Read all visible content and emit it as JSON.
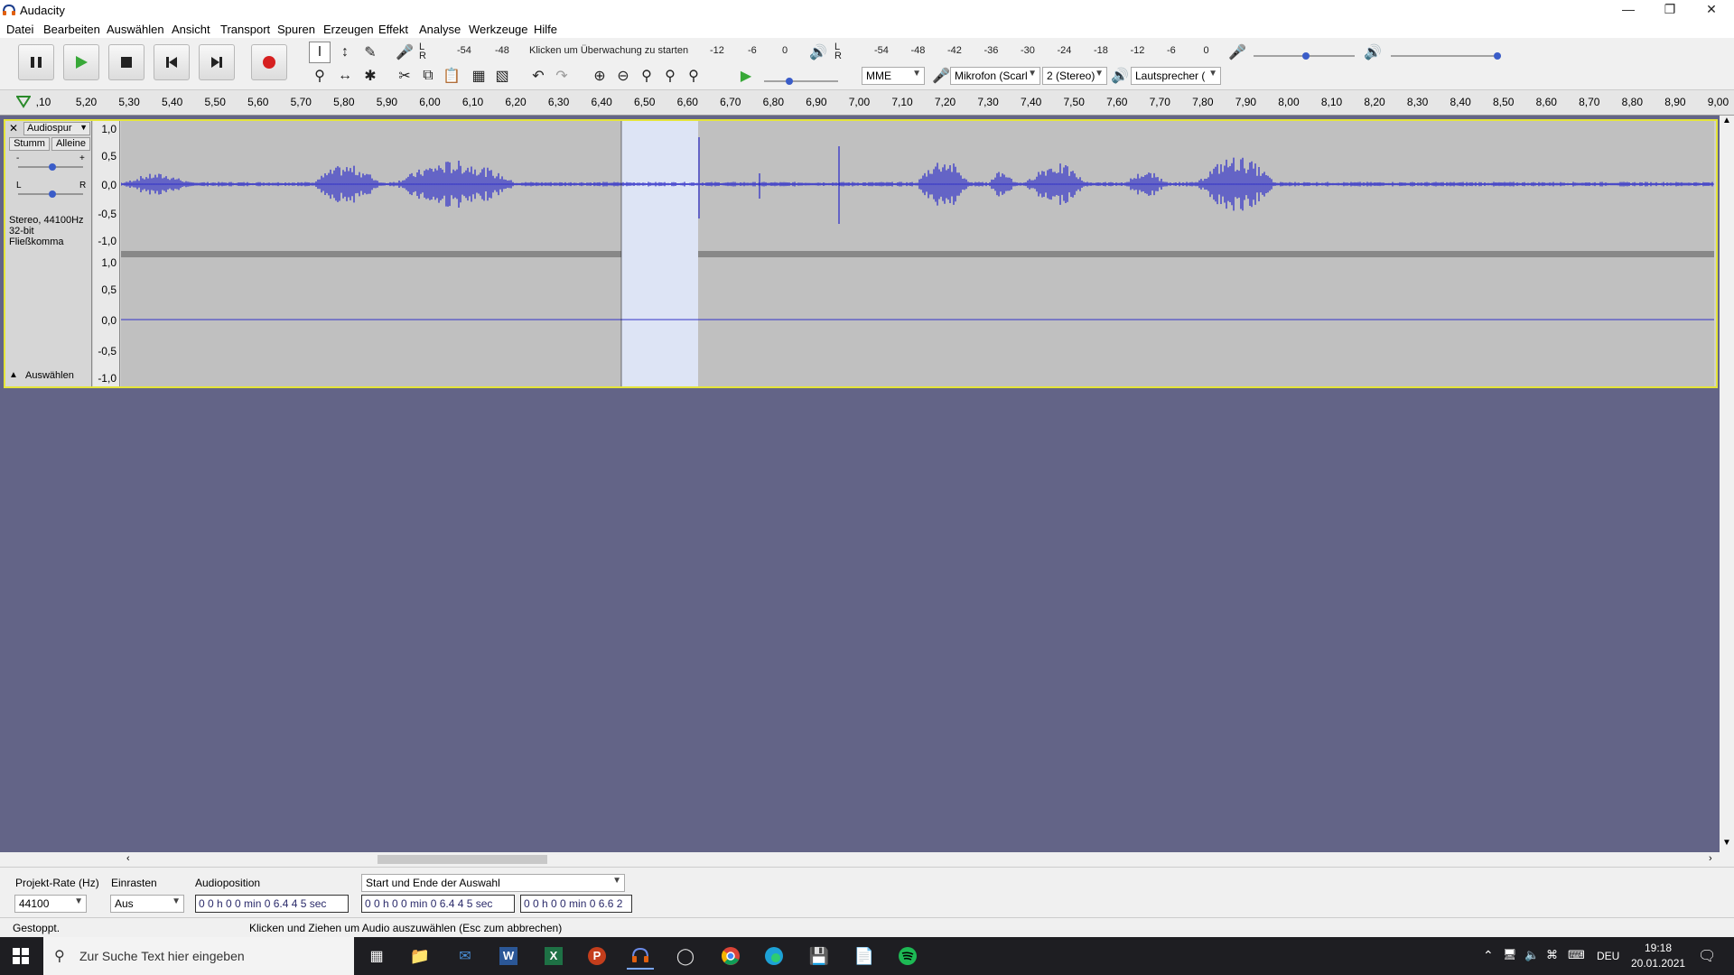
{
  "window": {
    "title": "Audacity"
  },
  "menu": [
    "Datei",
    "Bearbeiten",
    "Auswählen",
    "Ansicht",
    "Transport",
    "Spuren",
    "Erzeugen",
    "Effekt",
    "Analyse",
    "Werkzeuge",
    "Hilfe"
  ],
  "meter": {
    "record_ticks": [
      "-54",
      "-48"
    ],
    "record_hint": "Klicken um Überwachung zu starten",
    "record_ticks_right": [
      "-12",
      "-6",
      "0"
    ],
    "play_ticks": [
      "-54",
      "-48",
      "-42",
      "-36",
      "-30",
      "-24",
      "-18",
      "-12",
      "-6",
      "0"
    ]
  },
  "device": {
    "host": "MME",
    "mic": "Mikrofon (Scarl",
    "channels": "2 (Stereo)",
    "speaker": "Lautsprecher ("
  },
  "ruler": {
    "ticks": [
      ",10",
      "5,20",
      "5,30",
      "5,40",
      "5,50",
      "5,60",
      "5,70",
      "5,80",
      "5,90",
      "6,00",
      "6,10",
      "6,20",
      "6,30",
      "6,40",
      "6,50",
      "6,60",
      "6,70",
      "6,80",
      "6,90",
      "7,00",
      "7,10",
      "7,20",
      "7,30",
      "7,40",
      "7,50",
      "7,60",
      "7,70",
      "7,80",
      "7,90",
      "8,00",
      "8,10",
      "8,20",
      "8,30",
      "8,40",
      "8,50",
      "8,60",
      "8,70",
      "8,80",
      "8,90",
      "9,00"
    ]
  },
  "track": {
    "name": "Audiospur",
    "mute": "Stumm",
    "solo": "Alleine",
    "gain_minus": "-",
    "gain_plus": "+",
    "pan_left": "L",
    "pan_right": "R",
    "info_line1": "Stereo, 44100Hz",
    "info_line2": "32-bit Fließkomma",
    "select_label": "Auswählen",
    "vscale_top": [
      "1,0",
      "0,5",
      "0,0",
      "-0,5",
      "-1,0"
    ],
    "vscale_bottom": [
      "1,0",
      "0,5",
      "0,0",
      "-0,5",
      "-1,0"
    ],
    "colors": {
      "waveform": "#3232c8",
      "selection": "#dde4f5",
      "background": "#c0c0c0"
    }
  },
  "selection_toolbar": {
    "project_rate_label": "Projekt-Rate (Hz)",
    "project_rate_value": "44100",
    "snap_label": "Einrasten",
    "snap_value": "Aus",
    "position_label": "Audioposition",
    "position_value": "0 0 h 0 0 min 0 6.4 4 5 sec",
    "mode_value": "Start und Ende der Auswahl",
    "start_value": "0 0 h 0 0 min 0 6.4 4 5 sec",
    "end_value": "0 0 h 0 0 min 0 6.6 2"
  },
  "status": {
    "state": "Gestoppt.",
    "hint": "Klicken und Ziehen um Audio auszuwählen (Esc zum abbrechen)"
  },
  "taskbar": {
    "search_placeholder": "Zur Suche Text hier eingeben",
    "language": "DEU",
    "time": "19:18",
    "date": "20.01.2021"
  }
}
